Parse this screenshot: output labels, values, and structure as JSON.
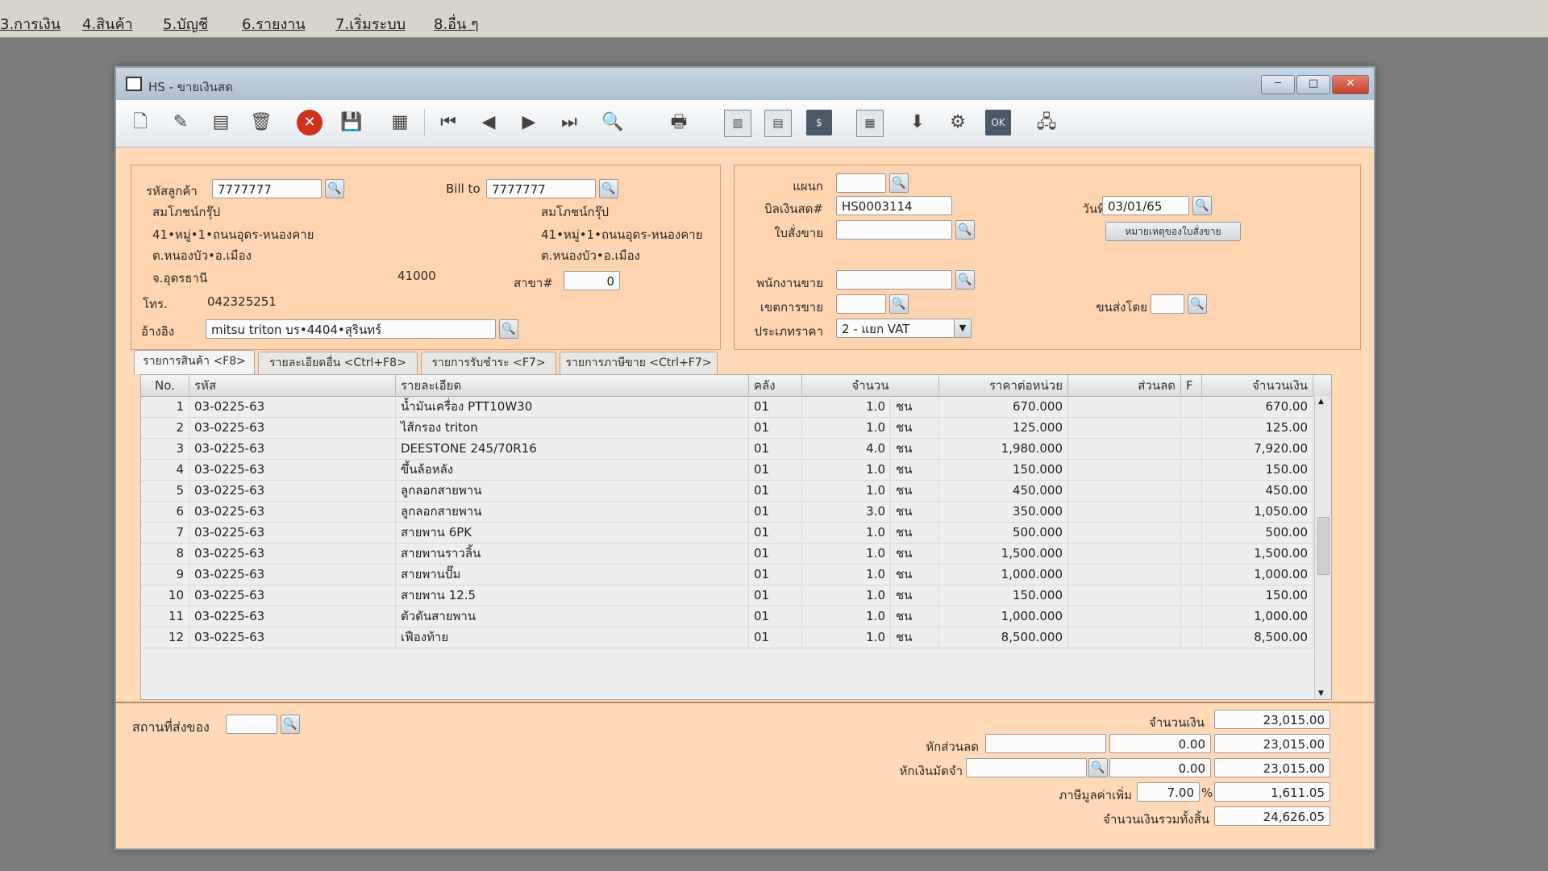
{
  "menubar": {
    "items": [
      "3.การเงิน",
      "4.สินค้า",
      "5.บัญชี",
      "6.รายงาน",
      "7.เริ่มระบบ",
      "8.อื่น ๆ"
    ]
  },
  "window": {
    "title": "HS - ขายเงินสด",
    "minimize": "─",
    "maximize": "□",
    "close": "✕"
  },
  "toolbar": {
    "icons": [
      "new-icon",
      "edit-icon",
      "book-icon",
      "trash-icon",
      "cancel-icon",
      "save-icon",
      "stack-icon",
      "first-icon",
      "prev-icon",
      "next-icon",
      "last-icon",
      "search-doc-icon",
      "print-icon",
      "grid-icon",
      "form-icon",
      "dollar-icon",
      "calendar-icon",
      "approve-icon",
      "link-icon",
      "ok-icon",
      "network-icon"
    ],
    "glyphs": [
      "🗋",
      "✎",
      "▤",
      "🗑",
      "✕",
      "💾",
      "▦",
      "⏮",
      "◀",
      "▶",
      "⏭",
      "🔍",
      "🖶",
      "▥",
      "▤",
      "$",
      "▦",
      "⬇",
      "⚙",
      "OK",
      "🖧"
    ]
  },
  "customer": {
    "code_label": "รหัสลูกค้า",
    "code": "7777777",
    "name": "สมโภชน์กรุ๊ป",
    "addr1": "41•หมู่•1•ถนนอุดร-หนองคาย",
    "addr2": "ต.หนองบัว•อ.เมือง",
    "province": "จ.อุดรธานี",
    "zip": "41000",
    "phone_label": "โทร.",
    "phone": "042325251",
    "ref_label": "อ้างอิง",
    "ref": "mitsu triton บร•4404•สุรินทร์"
  },
  "bill_to": {
    "label": "Bill to",
    "code": "7777777",
    "name": "สมโภชน์กรุ๊ป",
    "addr1": "41•หมู่•1•ถนนอุดร-หนองคาย",
    "addr2": "ต.หนองบัว•อ.เมือง",
    "branch_label": "สาขา#",
    "branch": "0"
  },
  "doc": {
    "dept_label": "แผนก",
    "dept": "",
    "bill_no_label": "บิลเงินสด#",
    "bill_no": "HS0003114",
    "order_label": "ใบสั่งขาย",
    "order": "",
    "date_label": "วันที่",
    "date": "03/01/65",
    "note_button": "หมายเหตุของใบสั่งขาย",
    "salesman_label": "พนักงานขาย",
    "salesman": "",
    "area_label": "เขตการขาย",
    "area": "",
    "ship_by_label": "ขนส่งโดย",
    "ship_by": "",
    "price_type_label": "ประเภทราคา",
    "price_type": "2 - แยก VAT"
  },
  "tabs": [
    {
      "label": "รายการสินค้า <F8>"
    },
    {
      "label": "รายละเอียดอื่น <Ctrl+F8>"
    },
    {
      "label": "รายการรับชำระ <F7>"
    },
    {
      "label": "รายการภาษีขาย <Ctrl+F7>"
    }
  ],
  "table": {
    "headers": [
      "No.",
      "รหัส",
      "รายละเอียด",
      "คลัง",
      "จำนวน",
      "ราคาต่อหน่วย",
      "ส่วนลด",
      "F",
      "จำนวนเงิน"
    ],
    "rows": [
      {
        "no": "1",
        "code": "03-0225-63",
        "desc": "น้ำมันเครื่อง PTT10W30",
        "wh": "01",
        "qty": "1.0",
        "unit": "ชน",
        "price": "670.000",
        "disc": "",
        "f": "",
        "amount": "670.00"
      },
      {
        "no": "2",
        "code": "03-0225-63",
        "desc": "ไส้กรอง triton",
        "wh": "01",
        "qty": "1.0",
        "unit": "ชน",
        "price": "125.000",
        "disc": "",
        "f": "",
        "amount": "125.00"
      },
      {
        "no": "3",
        "code": "03-0225-63",
        "desc": "DEESTONE 245/70R16",
        "wh": "01",
        "qty": "4.0",
        "unit": "ชน",
        "price": "1,980.000",
        "disc": "",
        "f": "",
        "amount": "7,920.00"
      },
      {
        "no": "4",
        "code": "03-0225-63",
        "desc": "ขึ้นล้อหลัง",
        "wh": "01",
        "qty": "1.0",
        "unit": "ชน",
        "price": "150.000",
        "disc": "",
        "f": "",
        "amount": "150.00"
      },
      {
        "no": "5",
        "code": "03-0225-63",
        "desc": "ลูกลอกสายพาน",
        "wh": "01",
        "qty": "1.0",
        "unit": "ชน",
        "price": "450.000",
        "disc": "",
        "f": "",
        "amount": "450.00"
      },
      {
        "no": "6",
        "code": "03-0225-63",
        "desc": "ลูกลอกสายพาน",
        "wh": "01",
        "qty": "3.0",
        "unit": "ชน",
        "price": "350.000",
        "disc": "",
        "f": "",
        "amount": "1,050.00"
      },
      {
        "no": "7",
        "code": "03-0225-63",
        "desc": "สายพาน 6PK",
        "wh": "01",
        "qty": "1.0",
        "unit": "ชน",
        "price": "500.000",
        "disc": "",
        "f": "",
        "amount": "500.00"
      },
      {
        "no": "8",
        "code": "03-0225-63",
        "desc": "สายพานราวลิ้น",
        "wh": "01",
        "qty": "1.0",
        "unit": "ชน",
        "price": "1,500.000",
        "disc": "",
        "f": "",
        "amount": "1,500.00"
      },
      {
        "no": "9",
        "code": "03-0225-63",
        "desc": "สายพานปั๊ม",
        "wh": "01",
        "qty": "1.0",
        "unit": "ชน",
        "price": "1,000.000",
        "disc": "",
        "f": "",
        "amount": "1,000.00"
      },
      {
        "no": "10",
        "code": "03-0225-63",
        "desc": "สายพาน 12.5",
        "wh": "01",
        "qty": "1.0",
        "unit": "ชน",
        "price": "150.000",
        "disc": "",
        "f": "",
        "amount": "150.00"
      },
      {
        "no": "11",
        "code": "03-0225-63",
        "desc": "ตัวดันสายพาน",
        "wh": "01",
        "qty": "1.0",
        "unit": "ชน",
        "price": "1,000.000",
        "disc": "",
        "f": "",
        "amount": "1,000.00"
      },
      {
        "no": "12",
        "code": "03-0225-63",
        "desc": "เฟืองท้าย",
        "wh": "01",
        "qty": "1.0",
        "unit": "ชน",
        "price": "8,500.000",
        "disc": "",
        "f": "",
        "amount": "8,500.00"
      }
    ]
  },
  "footer": {
    "ship_place_label": "สถานที่ส่งของ",
    "ship_place": "",
    "amount_label": "จำนวนเงิน",
    "amount": "23,015.00",
    "discount_label": "หักส่วนลด",
    "discount_input": "",
    "discount_value": "0.00",
    "after_discount": "23,015.00",
    "deposit_label": "หักเงินมัดจำ",
    "deposit_input": "",
    "deposit_value": "0.00",
    "after_deposit": "23,015.00",
    "vat_label": "ภาษีมูลค่าเพิ่ม",
    "vat_rate": "7.00",
    "vat_pct": "%",
    "vat_amount": "1,611.05",
    "total_label": "จำนวนเงินรวมทั้งสิ้น",
    "total": "24,626.05"
  },
  "icons": {
    "search_glyph": "🔍",
    "dropdown_glyph": "▼",
    "scroll_up_glyph": "▲",
    "scroll_down_glyph": "▼"
  }
}
